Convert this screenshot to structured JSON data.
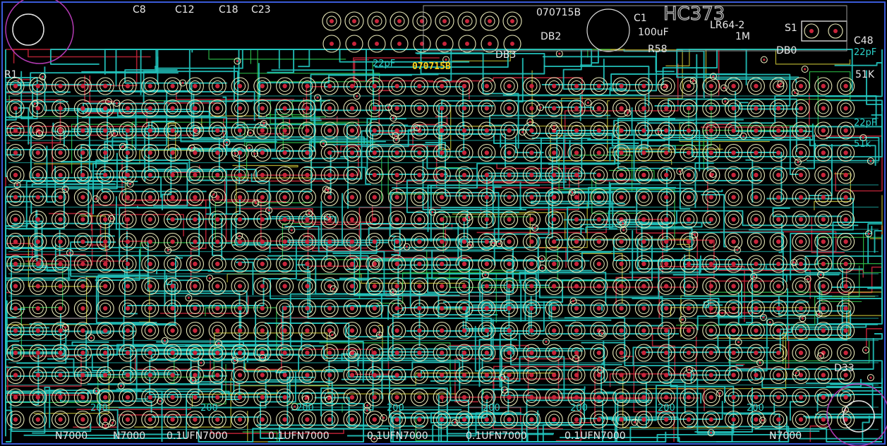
{
  "board": {
    "title_chip": "HC373",
    "build_code": "070715B",
    "build_code_highlight": "070715B",
    "colors": {
      "background": "#000000",
      "outline": "#3a5ad8",
      "top_trace": "#22c7c0",
      "bottom_trace": "#c8243a",
      "power_trace": "#d9d33a",
      "green_trace": "#2fcf4f",
      "silk": "#d9d9d9",
      "via_ring": "#f2f2c4",
      "mounting_hole": "#b23ab2"
    }
  },
  "labels": {
    "top_row": [
      {
        "id": "c8",
        "text": "C8"
      },
      {
        "id": "c12",
        "text": "C12"
      },
      {
        "id": "c18",
        "text": "C18"
      },
      {
        "id": "c23",
        "text": "C23"
      },
      {
        "id": "c1",
        "text": "C1"
      },
      {
        "id": "c1_value",
        "text": "100uF"
      },
      {
        "id": "s1",
        "text": "S1"
      },
      {
        "id": "c48",
        "text": "C48"
      },
      {
        "id": "c48_value",
        "text": "22pF"
      },
      {
        "id": "r1",
        "text": "R1"
      },
      {
        "id": "db2",
        "text": "DB2"
      },
      {
        "id": "db3",
        "text": "DB3"
      },
      {
        "id": "db0",
        "text": "DB0"
      },
      {
        "id": "r58",
        "text": "R58"
      },
      {
        "id": "r51k",
        "text": "51K"
      },
      {
        "id": "rb4",
        "text": "LR64-2"
      },
      {
        "id": "val_1m",
        "text": "1M"
      },
      {
        "id": "val_22pf",
        "text": "22pF"
      }
    ],
    "right_side": [
      {
        "id": "d33",
        "text": "D33"
      },
      {
        "id": "r_right",
        "text": "51k"
      },
      {
        "id": "c_right",
        "text": "22pF"
      }
    ],
    "bottom_row": [
      {
        "id": "b1",
        "text": "N7000"
      },
      {
        "id": "b2",
        "text": "N7000"
      },
      {
        "id": "b3",
        "text": "0.1UFN7000"
      },
      {
        "id": "b4",
        "text": "0.1UFN7000"
      },
      {
        "id": "b5",
        "text": "0.1UFN7000"
      },
      {
        "id": "b6",
        "text": "0.1UFN7000"
      },
      {
        "id": "b7",
        "text": "0.1UFN7000"
      },
      {
        "id": "b8",
        "text": "N7000"
      }
    ],
    "row_values": [
      {
        "id": "v1",
        "text": "200"
      },
      {
        "id": "v2",
        "text": "200"
      },
      {
        "id": "v3",
        "text": "200"
      },
      {
        "id": "v4",
        "text": "200"
      },
      {
        "id": "v5",
        "text": "200"
      },
      {
        "id": "v6",
        "text": "200"
      },
      {
        "id": "v7",
        "text": "200"
      },
      {
        "id": "v8",
        "text": "200"
      }
    ]
  }
}
